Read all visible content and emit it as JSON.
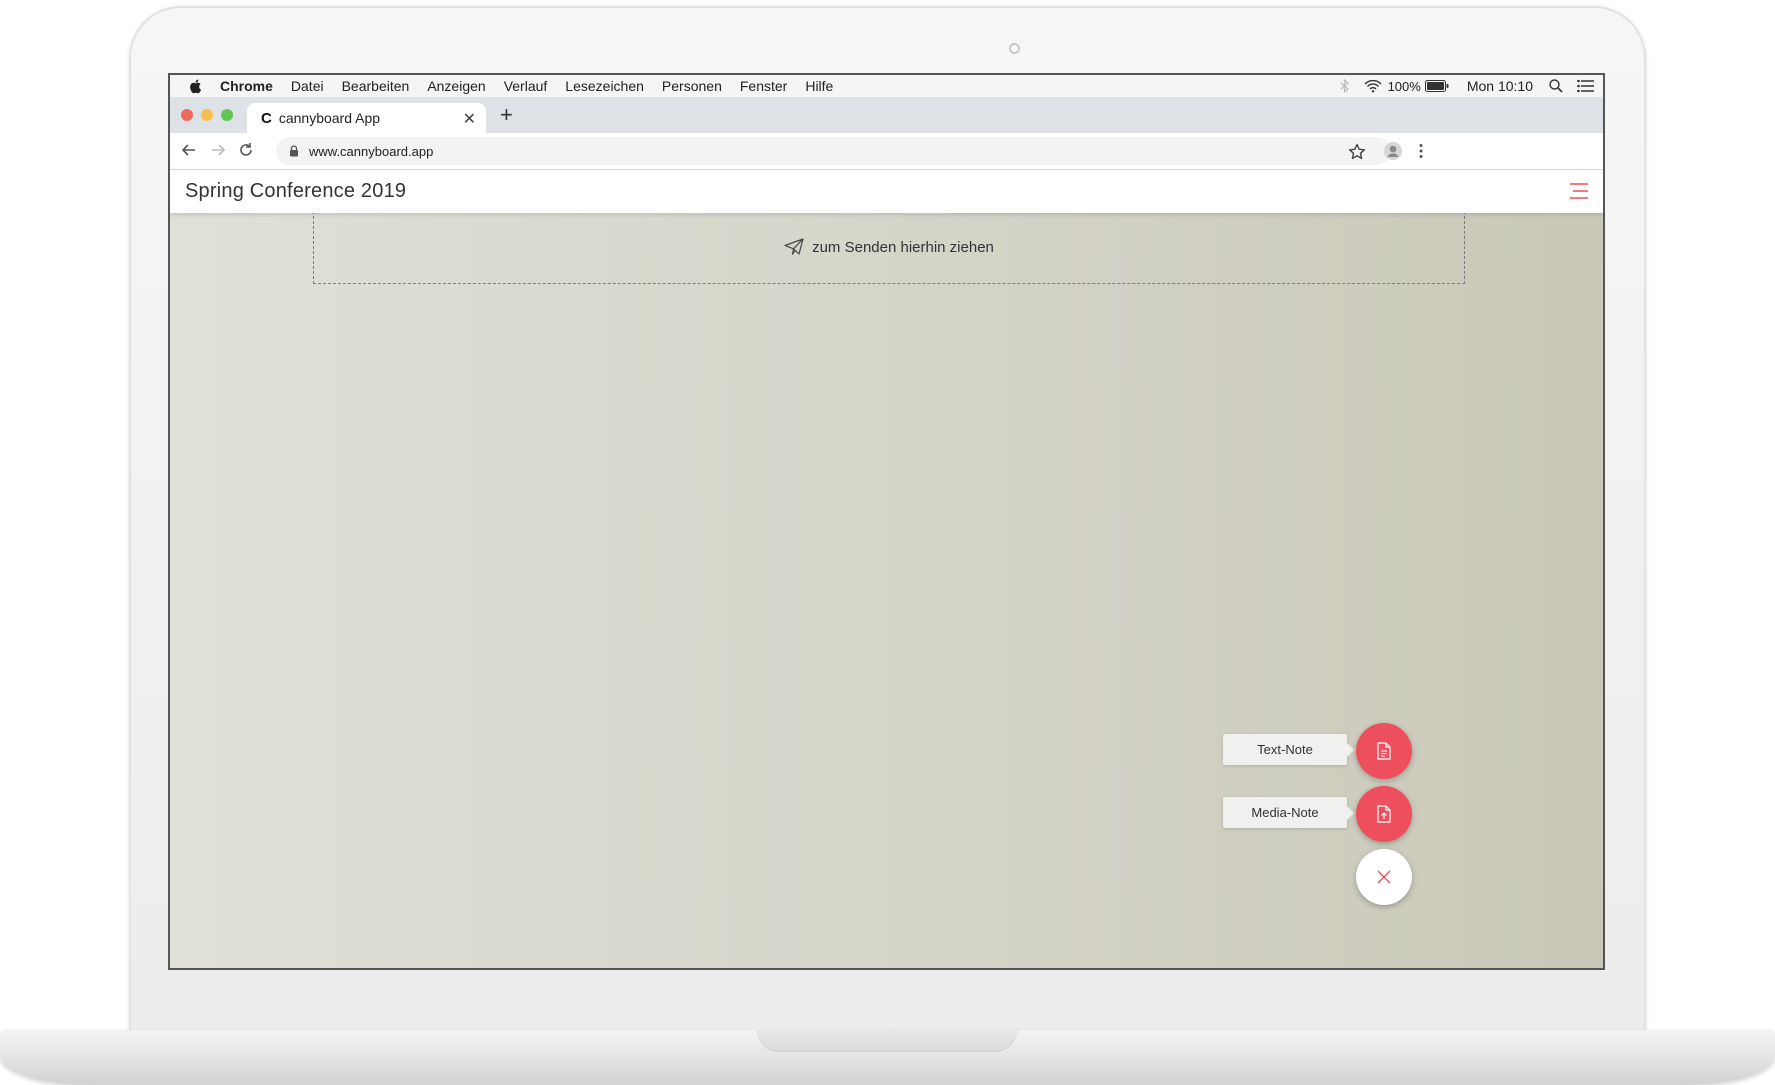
{
  "menubar": {
    "app": "Chrome",
    "items": [
      "Datei",
      "Bearbeiten",
      "Anzeigen",
      "Verlauf",
      "Lesezeichen",
      "Personen",
      "Fenster",
      "Hilfe"
    ],
    "battery": "100%",
    "clock": "Mon 10:10"
  },
  "browser": {
    "tab_title": "cannyboard App",
    "tab_favicon": "C",
    "url": "www.cannyboard.app"
  },
  "app": {
    "title": "Spring Conference 2019",
    "dropzone_text": "zum Senden hierhin ziehen",
    "fab_text_note": "Text-Note",
    "fab_media_note": "Media-Note",
    "accent_color": "#ed4f5c"
  }
}
